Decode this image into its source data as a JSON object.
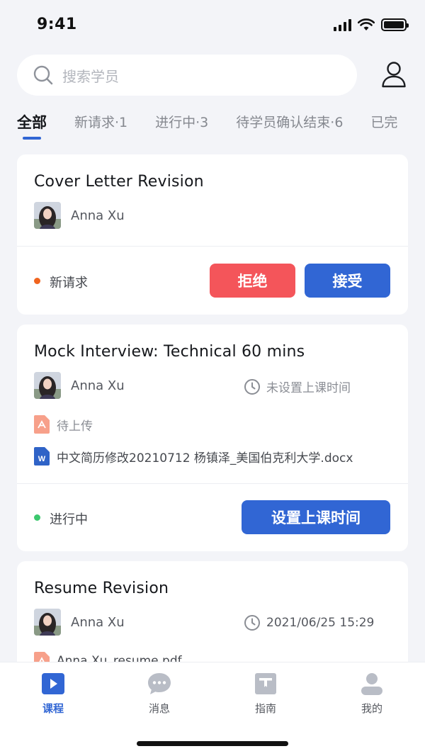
{
  "status_bar": {
    "time": "9:41"
  },
  "search": {
    "placeholder": "搜索学员"
  },
  "tabs": [
    {
      "label": "全部"
    },
    {
      "label": "新请求·1"
    },
    {
      "label": "进行中·3"
    },
    {
      "label": "待学员确认结束·6"
    },
    {
      "label": "已完"
    }
  ],
  "cards": [
    {
      "title": "Cover Letter Revision",
      "student": "Anna Xu",
      "status": "新请求",
      "status_color": "#f0641e",
      "reject_label": "拒绝",
      "accept_label": "接受"
    },
    {
      "title": "Mock Interview: Technical 60 mins",
      "student": "Anna Xu",
      "time": "未设置上课时间",
      "pending_file": "待上传",
      "file": "中文简历修改20210712 杨镇泽_美国伯克利大学.docx",
      "status": "进行中",
      "status_color": "#3cc86e",
      "action_label": "设置上课时间"
    },
    {
      "title": "Resume Revision",
      "student": "Anna Xu",
      "time": "2021/06/25 15:29",
      "file": "Anna Xu_resume.pdf"
    }
  ],
  "bottom_nav": [
    {
      "label": "课程",
      "icon": "course-icon"
    },
    {
      "label": "消息",
      "icon": "message-icon"
    },
    {
      "label": "指南",
      "icon": "guide-icon"
    },
    {
      "label": "我的",
      "icon": "profile-icon"
    }
  ],
  "colors": {
    "accent": "#3166d4",
    "danger": "#f4555a"
  }
}
